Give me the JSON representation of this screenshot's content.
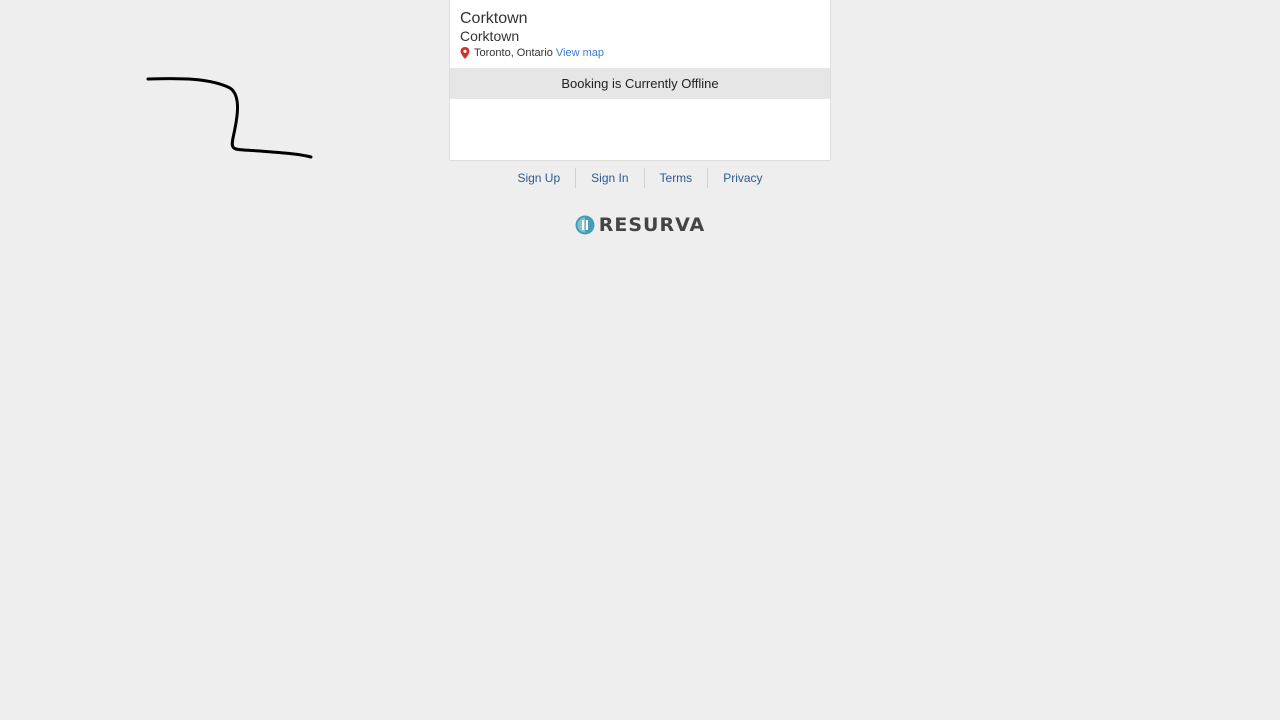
{
  "business": {
    "name": "Corktown",
    "location_name": "Corktown",
    "city": "Toronto, Ontario",
    "view_map_label": "View map"
  },
  "booking": {
    "status_text": "Booking is Currently Offline"
  },
  "footer": {
    "links": [
      "Sign Up",
      "Sign In",
      "Terms",
      "Privacy"
    ]
  },
  "brand": {
    "logo_text": "RESURVA",
    "logo_color": "#4a9bb5"
  },
  "icons": {
    "location": "map-pin-icon",
    "logo": "resurva-logo-icon"
  },
  "colors": {
    "background": "#eeeeee",
    "link": "#2c5a8f",
    "map_link": "#3a7bd5",
    "pin": "#d0312d"
  }
}
